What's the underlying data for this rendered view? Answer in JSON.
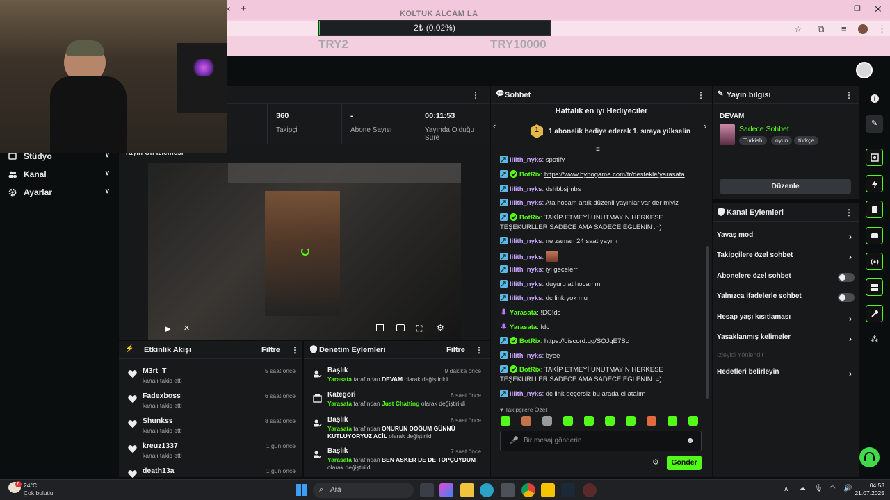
{
  "browser": {
    "goal_title": "KOLTUK ALCAM LA",
    "goal_progress_text": "2₺ (0.02%)",
    "goal_progress_fraction": 0.0002,
    "goal_min": "TRY2",
    "goal_max": "TRY10000",
    "tab_close": "×",
    "tab_new": "+"
  },
  "sidebar": {
    "items": [
      {
        "label": "Stüdyo",
        "icon": "studio-icon"
      },
      {
        "label": "Kanal",
        "icon": "users-icon"
      },
      {
        "label": "Ayarlar",
        "icon": "gear-icon"
      }
    ]
  },
  "stats": {
    "items": [
      {
        "value": "360",
        "label": "Takipçi"
      },
      {
        "value": "-",
        "label": "Abone Sayısı"
      },
      {
        "value": "00:11:53",
        "label": "Yayında Olduğu Süre"
      }
    ]
  },
  "preview": {
    "title": "Yayın Ön İzlemesi"
  },
  "activity": {
    "title": "Etkinlik Akışı",
    "filter": "Filtre",
    "rows": [
      {
        "name": "M3rt_T",
        "sub": "kanalı takip etti",
        "time": "5 saat önce"
      },
      {
        "name": "Fadexboss",
        "sub": "kanalı takip etti",
        "time": "6 saat önce"
      },
      {
        "name": "Shunkss",
        "sub": "kanalı takip etti",
        "time": "8 saat önce"
      },
      {
        "name": "kreuz1337",
        "sub": "kanalı takip etti",
        "time": "1 gün önce"
      },
      {
        "name": "death13a",
        "sub": "",
        "time": "1 gün önce"
      }
    ]
  },
  "moderation": {
    "title": "Denetim Eylemleri",
    "filter": "Filtre",
    "rows": [
      {
        "title": "Başlık",
        "time": "9 dakika önce",
        "user": "Yarasata",
        "mid": "tarafından",
        "value": "DEVAM",
        "end": "olarak değiştirildi"
      },
      {
        "title": "Kategori",
        "time": "6 saat önce",
        "user": "Yarasata",
        "mid": "tarafından",
        "value": "Just Chatting",
        "end": "olarak değiştirildi"
      },
      {
        "title": "Başlık",
        "time": "6 saat önce",
        "user": "Yarasata",
        "mid": "tarafından",
        "value": "ONURUN DOĞUM GÜNNÜ KUTLUYORYUZ ACİL",
        "end": "olarak değiştirildi"
      },
      {
        "title": "Başlık",
        "time": "7 saat önce",
        "user": "Yarasata",
        "mid": "tarafından",
        "value": "BEN ASKER DE DE TOPÇUYDUM",
        "end": "olarak değiştirildi"
      }
    ]
  },
  "chat": {
    "title": "Sohbet",
    "gifters_title": "Haftalık en iyi Hediyeciler",
    "gifters_rank": "1",
    "gifters_text": "1 abonelik hediye ederek 1. sıraya yükselin",
    "messages": [
      {
        "user": "lilith_nyks",
        "color": "purple",
        "text": "spotify"
      },
      {
        "user": "BotRix",
        "color": "green",
        "verified": true,
        "text": "https://www.bynogame.com/tr/destekle/yarasata",
        "link": true
      },
      {
        "user": "lilith_nyks",
        "color": "purple",
        "text": "dshbbsjmbs"
      },
      {
        "user": "lilith_nyks",
        "color": "purple",
        "text": "Ata hocam artık düzenli yayınlar var der miyiz"
      },
      {
        "user": "BotRix",
        "color": "green",
        "verified": true,
        "text": "TAKİP ETMEYİ UNUTMAYIN HERKESE TEŞEKÜRLLER SADECE AMA SADECE EĞLENİN :=)"
      },
      {
        "user": "lilith_nyks",
        "color": "purple",
        "text": "ne zaman 24 saat yayını"
      },
      {
        "user": "lilith_nyks",
        "color": "purple",
        "text": "",
        "emote": true
      },
      {
        "user": "lilith_nyks",
        "color": "purple",
        "text": "iyi gecelerr"
      },
      {
        "user": "lilith_nyks",
        "color": "purple",
        "text": "duyuru at hocamm"
      },
      {
        "user": "lilith_nyks",
        "color": "purple",
        "text": "dc link yok mu"
      },
      {
        "user": "Yarasata",
        "color": "green",
        "mic": true,
        "text": "!DC!dc"
      },
      {
        "user": "Yarasata",
        "color": "green",
        "mic": true,
        "text": "!dc"
      },
      {
        "user": "BotRix",
        "color": "green",
        "verified": true,
        "text": "https://discord.gg/SQJgE7Sc",
        "link": true
      },
      {
        "user": "lilith_nyks",
        "color": "purple",
        "text": "byee"
      },
      {
        "user": "BotRix",
        "color": "green",
        "verified": true,
        "text": "TAKİP ETMEYİ UNUTMAYIN HERKESE TEŞEKÜRLLER SADECE AMA SADECE EĞLENİN :=)"
      },
      {
        "user": "lilith_nyks",
        "color": "purple",
        "text": "dc link geçersiz bu arada el atalım"
      }
    ],
    "followers_only": "Takipçilere Özel",
    "input_placeholder": "Bir mesaj gönderin",
    "send": "Gönder"
  },
  "stream_info": {
    "title": "Yayın bilgisi",
    "stream_title": "DEVAM",
    "category": "Sadece Sohbet",
    "tags": [
      "Turkish",
      "oyun",
      "türkçe"
    ],
    "edit": "Düzenle"
  },
  "channel_actions": {
    "title": "Kanal Eylemleri",
    "rows": [
      {
        "label": "Yavaş mod",
        "kind": "arrow"
      },
      {
        "label": "Takipçilere özel sohbet",
        "kind": "arrow"
      },
      {
        "label": "Abonelere özel sohbet",
        "kind": "toggle"
      },
      {
        "label": "Yalnızca ifadelerle sohbet",
        "kind": "toggle"
      },
      {
        "label": "Hesap yaşı kısıtlaması",
        "kind": "arrow"
      },
      {
        "label": "Yasaklanmış kelimeler",
        "kind": "arrow"
      },
      {
        "label": "İzleyici Yönlendir",
        "kind": "disabled"
      },
      {
        "label": "Hedefleri belirleyin",
        "kind": "arrow"
      }
    ]
  },
  "taskbar": {
    "weather_temp": "24°C",
    "weather_desc": "Çok bulutlu",
    "weather_badge": "6",
    "search": "Ara",
    "time": "04:53",
    "date": "21.07.2025"
  },
  "colors": {
    "accent": "#53fc18",
    "panel": "#18191b",
    "bg": "#0b0e0f",
    "chrome_pink": "#f4cfe0"
  }
}
